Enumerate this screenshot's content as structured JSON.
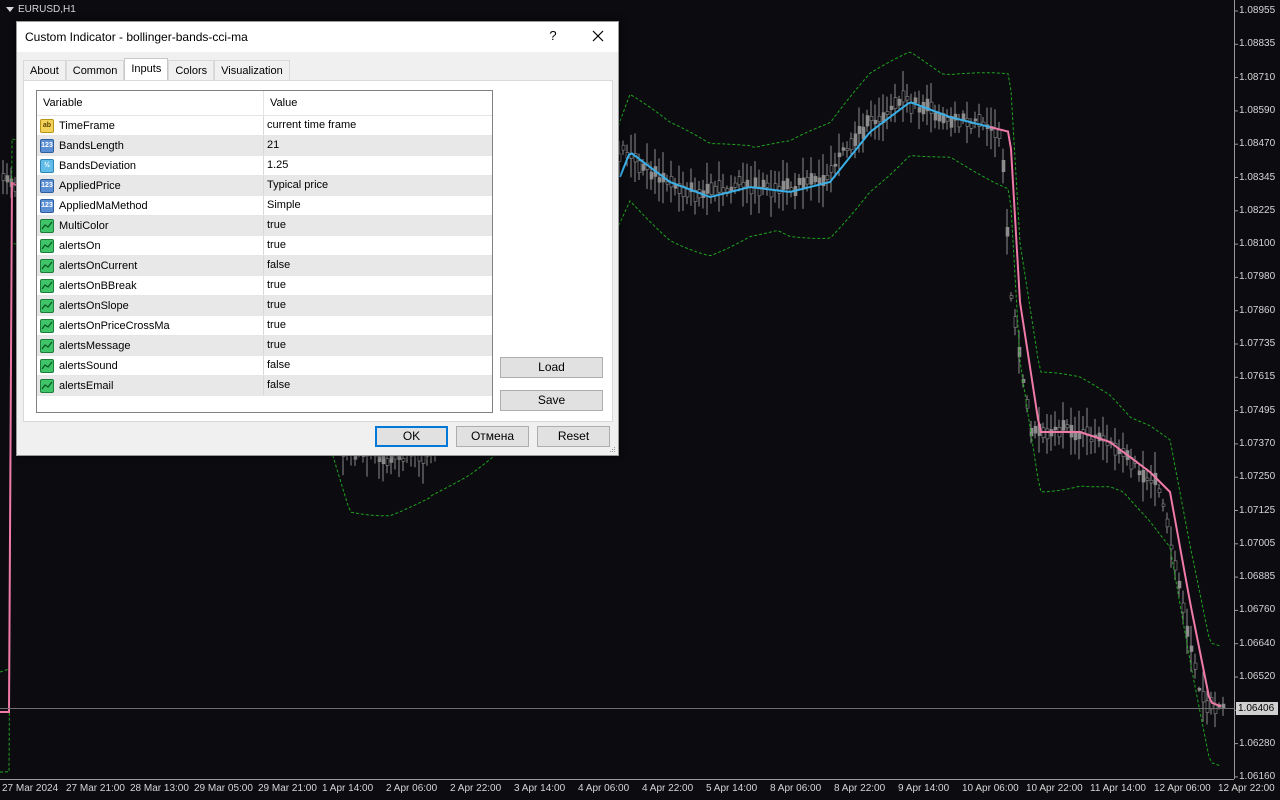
{
  "chart": {
    "symbol": "EURUSD,H1",
    "current_price": "1.06406",
    "price_labels": [
      "1.08955",
      "1.08835",
      "1.08710",
      "1.08590",
      "1.08470",
      "1.08345",
      "1.08225",
      "1.08100",
      "1.07980",
      "1.07860",
      "1.07735",
      "1.07615",
      "1.07495",
      "1.07370",
      "1.07250",
      "1.07125",
      "1.07005",
      "1.06885",
      "1.06760",
      "1.06640",
      "1.06520",
      "1.06400",
      "1.06280",
      "1.06160"
    ],
    "time_labels": [
      "27 Mar 2024",
      "27 Mar 21:00",
      "28 Mar 13:00",
      "29 Mar 05:00",
      "29 Mar 21:00",
      "1 Apr 14:00",
      "2 Apr 06:00",
      "2 Apr 22:00",
      "3 Apr 14:00",
      "4 Apr 06:00",
      "4 Apr 22:00",
      "5 Apr 14:00",
      "8 Apr 06:00",
      "8 Apr 22:00",
      "9 Apr 14:00",
      "10 Apr 06:00",
      "10 Apr 22:00",
      "11 Apr 14:00",
      "12 Apr 06:00",
      "12 Apr 22:00"
    ],
    "colors": {
      "background": "#0b0b10",
      "candle": "#8c8c8c",
      "band": "#1fa31f",
      "ma_up": "#3ab0e8",
      "ma_down": "#f07aa8"
    }
  },
  "dialog": {
    "title": "Custom Indicator - bollinger-bands-cci-ma",
    "help": "?",
    "tabs": [
      "About",
      "Common",
      "Inputs",
      "Colors",
      "Visualization"
    ],
    "active_tab": "Inputs",
    "columns": {
      "variable": "Variable",
      "value": "Value"
    },
    "rows": [
      {
        "type": "str",
        "icon": "ab",
        "name": "TimeFrame",
        "value": "current time frame"
      },
      {
        "type": "int",
        "icon": "123",
        "name": "BandsLength",
        "value": "21"
      },
      {
        "type": "dbl",
        "icon": "½",
        "name": "BandsDeviation",
        "value": "1.25"
      },
      {
        "type": "int",
        "icon": "123",
        "name": "AppliedPrice",
        "value": "Typical price"
      },
      {
        "type": "int",
        "icon": "123",
        "name": "AppliedMaMethod",
        "value": "Simple"
      },
      {
        "type": "bool",
        "icon": "",
        "name": "MultiColor",
        "value": "true"
      },
      {
        "type": "bool",
        "icon": "",
        "name": "alertsOn",
        "value": "true"
      },
      {
        "type": "bool",
        "icon": "",
        "name": "alertsOnCurrent",
        "value": "false"
      },
      {
        "type": "bool",
        "icon": "",
        "name": "alertsOnBBreak",
        "value": "true"
      },
      {
        "type": "bool",
        "icon": "",
        "name": "alertsOnSlope",
        "value": "true"
      },
      {
        "type": "bool",
        "icon": "",
        "name": "alertsOnPriceCrossMa",
        "value": "true"
      },
      {
        "type": "bool",
        "icon": "",
        "name": "alertsMessage",
        "value": "true"
      },
      {
        "type": "bool",
        "icon": "",
        "name": "alertsSound",
        "value": "false"
      },
      {
        "type": "bool",
        "icon": "",
        "name": "alertsEmail",
        "value": "false"
      }
    ],
    "buttons": {
      "load": "Load",
      "save": "Save",
      "ok": "OK",
      "cancel": "Отмена",
      "reset": "Reset"
    }
  }
}
